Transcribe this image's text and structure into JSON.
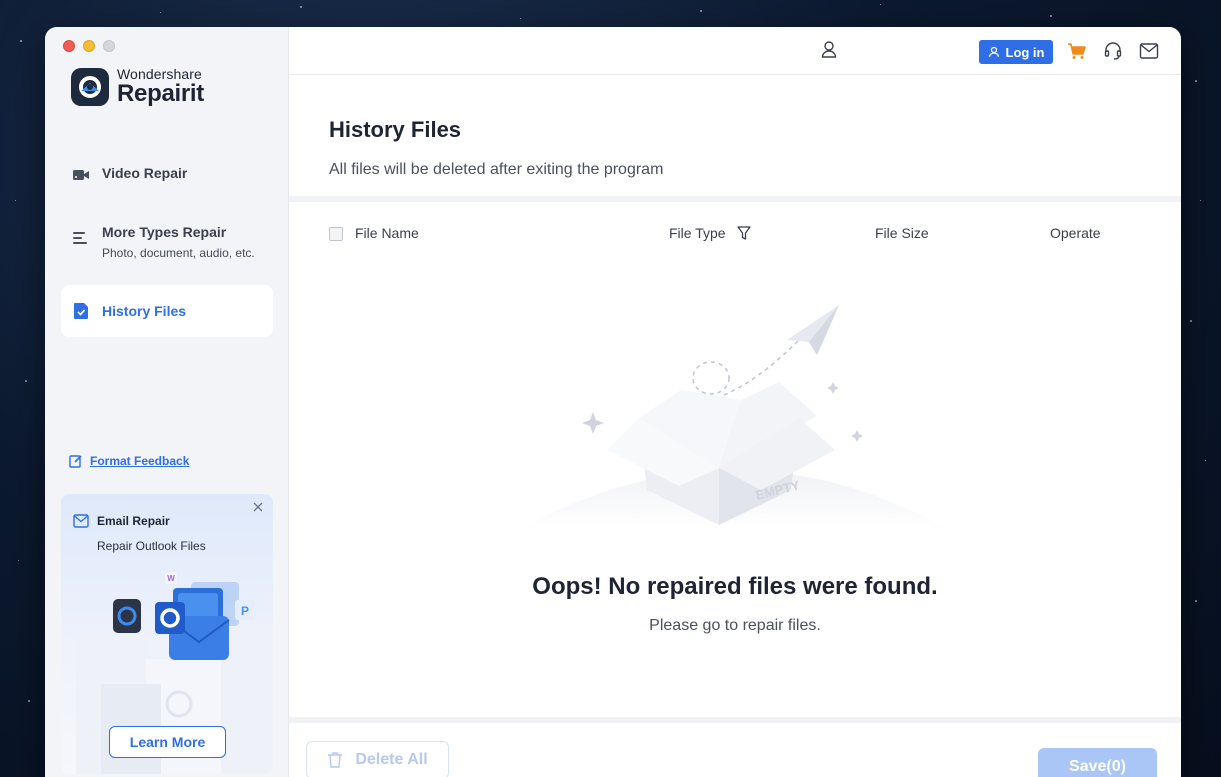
{
  "brand": {
    "top": "Wondershare",
    "bottom": "Repairit"
  },
  "sidebar": {
    "items": [
      {
        "label": "Video Repair",
        "sub": "",
        "icon": "video-icon"
      },
      {
        "label": "More Types Repair",
        "sub": "Photo, document, audio, etc.",
        "icon": "list-icon"
      },
      {
        "label": "History Files",
        "sub": "",
        "icon": "history-file-icon",
        "active": true
      }
    ],
    "feedback": "Format Feedback"
  },
  "promo": {
    "title": "Email Repair",
    "subtitle": "Repair Outlook Files",
    "button": "Learn More"
  },
  "topbar": {
    "login": "Log in"
  },
  "page": {
    "title": "History Files",
    "subtitle": "All files will be deleted after exiting the program"
  },
  "table": {
    "columns": [
      "File Name",
      "File Type",
      "File Size",
      "Operate"
    ]
  },
  "empty": {
    "art_label": "EMPTY",
    "title": "Oops! No repaired files were found.",
    "subtitle": "Please go to repair files."
  },
  "footer": {
    "delete_all": "Delete All",
    "save": "Save(0)"
  },
  "colors": {
    "accent": "#2e6ee6",
    "cart": "#f08c1e",
    "disabled_save": "#a9c6f6"
  }
}
